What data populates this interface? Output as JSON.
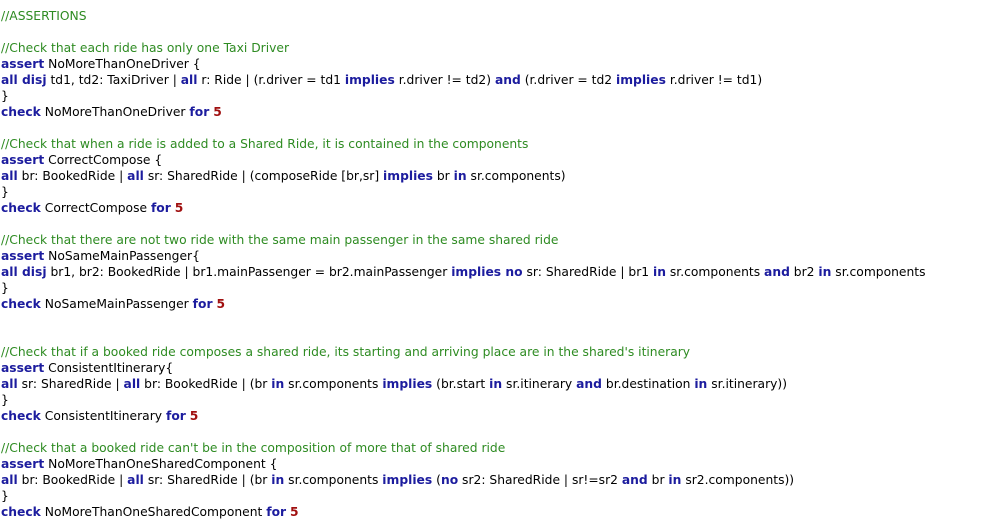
{
  "colors": {
    "background": "#ffffff",
    "comment": "#2e8b22",
    "keyword": "#1c1c9e",
    "number": "#a01010",
    "text": "#000000"
  },
  "lines": [
    [
      {
        "t": "//ASSERTIONS",
        "c": "comment"
      }
    ],
    [],
    [
      {
        "t": "//Check that each ride has only one Taxi Driver",
        "c": "comment"
      }
    ],
    [
      {
        "t": "assert",
        "c": "keyword"
      },
      {
        "t": " NoMoreThanOneDriver {",
        "c": "plain"
      }
    ],
    [
      {
        "t": "all disj",
        "c": "keyword"
      },
      {
        "t": " td1, td2: TaxiDriver | ",
        "c": "plain"
      },
      {
        "t": "all",
        "c": "keyword"
      },
      {
        "t": " r: Ride | (r.driver = td1 ",
        "c": "plain"
      },
      {
        "t": "implies",
        "c": "keyword"
      },
      {
        "t": " r.driver != td2) ",
        "c": "plain"
      },
      {
        "t": "and",
        "c": "keyword"
      },
      {
        "t": " (r.driver = td2 ",
        "c": "plain"
      },
      {
        "t": "implies",
        "c": "keyword"
      },
      {
        "t": " r.driver != td1)",
        "c": "plain"
      }
    ],
    [
      {
        "t": "}",
        "c": "plain"
      }
    ],
    [
      {
        "t": "check",
        "c": "keyword"
      },
      {
        "t": " NoMoreThanOneDriver ",
        "c": "plain"
      },
      {
        "t": "for",
        "c": "keyword"
      },
      {
        "t": " ",
        "c": "plain"
      },
      {
        "t": "5",
        "c": "number"
      }
    ],
    [],
    [
      {
        "t": "//Check that when a ride is added to a Shared Ride, it is contained in the components",
        "c": "comment"
      }
    ],
    [
      {
        "t": "assert",
        "c": "keyword"
      },
      {
        "t": " CorrectCompose {",
        "c": "plain"
      }
    ],
    [
      {
        "t": "all",
        "c": "keyword"
      },
      {
        "t": " br: BookedRide | ",
        "c": "plain"
      },
      {
        "t": "all",
        "c": "keyword"
      },
      {
        "t": " sr: SharedRide | (composeRide [br,sr] ",
        "c": "plain"
      },
      {
        "t": "implies",
        "c": "keyword"
      },
      {
        "t": " br ",
        "c": "plain"
      },
      {
        "t": "in",
        "c": "keyword"
      },
      {
        "t": " sr.components)",
        "c": "plain"
      }
    ],
    [
      {
        "t": "}",
        "c": "plain"
      }
    ],
    [
      {
        "t": "check",
        "c": "keyword"
      },
      {
        "t": " CorrectCompose ",
        "c": "plain"
      },
      {
        "t": "for",
        "c": "keyword"
      },
      {
        "t": " ",
        "c": "plain"
      },
      {
        "t": "5",
        "c": "number"
      }
    ],
    [],
    [
      {
        "t": "//Check that there are not two ride with the same main passenger in the same shared ride",
        "c": "comment"
      }
    ],
    [
      {
        "t": "assert",
        "c": "keyword"
      },
      {
        "t": " NoSameMainPassenger{",
        "c": "plain"
      }
    ],
    [
      {
        "t": "all disj",
        "c": "keyword"
      },
      {
        "t": " br1, br2: BookedRide | br1.mainPassenger = br2.mainPassenger ",
        "c": "plain"
      },
      {
        "t": "implies no",
        "c": "keyword"
      },
      {
        "t": " sr: SharedRide | br1 ",
        "c": "plain"
      },
      {
        "t": "in",
        "c": "keyword"
      },
      {
        "t": " sr.components ",
        "c": "plain"
      },
      {
        "t": "and",
        "c": "keyword"
      },
      {
        "t": " br2 ",
        "c": "plain"
      },
      {
        "t": "in",
        "c": "keyword"
      },
      {
        "t": " sr.components",
        "c": "plain"
      }
    ],
    [
      {
        "t": "}",
        "c": "plain"
      }
    ],
    [
      {
        "t": "check",
        "c": "keyword"
      },
      {
        "t": " NoSameMainPassenger ",
        "c": "plain"
      },
      {
        "t": "for",
        "c": "keyword"
      },
      {
        "t": " ",
        "c": "plain"
      },
      {
        "t": "5",
        "c": "number"
      }
    ],
    [],
    [],
    [
      {
        "t": "//Check that if a booked ride composes a shared ride, its starting and arriving place are in the shared's itinerary",
        "c": "comment"
      }
    ],
    [
      {
        "t": "assert",
        "c": "keyword"
      },
      {
        "t": " ConsistentItinerary{",
        "c": "plain"
      }
    ],
    [
      {
        "t": "all",
        "c": "keyword"
      },
      {
        "t": " sr: SharedRide | ",
        "c": "plain"
      },
      {
        "t": "all",
        "c": "keyword"
      },
      {
        "t": " br: BookedRide | (br ",
        "c": "plain"
      },
      {
        "t": "in",
        "c": "keyword"
      },
      {
        "t": " sr.components ",
        "c": "plain"
      },
      {
        "t": "implies",
        "c": "keyword"
      },
      {
        "t": " (br.start ",
        "c": "plain"
      },
      {
        "t": "in",
        "c": "keyword"
      },
      {
        "t": " sr.itinerary ",
        "c": "plain"
      },
      {
        "t": "and",
        "c": "keyword"
      },
      {
        "t": " br.destination ",
        "c": "plain"
      },
      {
        "t": "in",
        "c": "keyword"
      },
      {
        "t": " sr.itinerary))",
        "c": "plain"
      }
    ],
    [
      {
        "t": "}",
        "c": "plain"
      }
    ],
    [
      {
        "t": "check",
        "c": "keyword"
      },
      {
        "t": " ConsistentItinerary ",
        "c": "plain"
      },
      {
        "t": "for",
        "c": "keyword"
      },
      {
        "t": " ",
        "c": "plain"
      },
      {
        "t": "5",
        "c": "number"
      }
    ],
    [],
    [
      {
        "t": "//Check that a booked ride can't be in the composition of more that of shared ride",
        "c": "comment"
      }
    ],
    [
      {
        "t": "assert",
        "c": "keyword"
      },
      {
        "t": " NoMoreThanOneSharedComponent {",
        "c": "plain"
      }
    ],
    [
      {
        "t": "all",
        "c": "keyword"
      },
      {
        "t": " br: BookedRide | ",
        "c": "plain"
      },
      {
        "t": "all",
        "c": "keyword"
      },
      {
        "t": " sr: SharedRide | (br ",
        "c": "plain"
      },
      {
        "t": "in",
        "c": "keyword"
      },
      {
        "t": " sr.components ",
        "c": "plain"
      },
      {
        "t": "implies",
        "c": "keyword"
      },
      {
        "t": " (",
        "c": "plain"
      },
      {
        "t": "no",
        "c": "keyword"
      },
      {
        "t": " sr2: SharedRide | sr!=sr2 ",
        "c": "plain"
      },
      {
        "t": "and",
        "c": "keyword"
      },
      {
        "t": " br ",
        "c": "plain"
      },
      {
        "t": "in",
        "c": "keyword"
      },
      {
        "t": " sr2.components))",
        "c": "plain"
      }
    ],
    [
      {
        "t": "}",
        "c": "plain"
      }
    ],
    [
      {
        "t": "check",
        "c": "keyword"
      },
      {
        "t": " NoMoreThanOneSharedComponent ",
        "c": "plain"
      },
      {
        "t": "for",
        "c": "keyword"
      },
      {
        "t": " ",
        "c": "plain"
      },
      {
        "t": "5",
        "c": "number"
      }
    ]
  ]
}
